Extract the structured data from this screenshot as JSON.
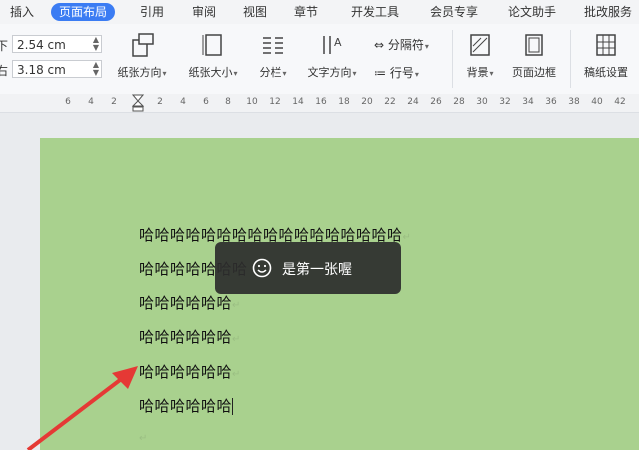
{
  "menu": {
    "tabs": [
      "插入",
      "页面布局",
      "引用",
      "审阅",
      "视图",
      "章节",
      "开发工具",
      "会员专享",
      "论文助手",
      "批改服务"
    ]
  },
  "ribbon": {
    "margins": {
      "label1": "下",
      "value1": "2.54 cm",
      "label2": "右",
      "value2": "3.18 cm"
    },
    "buttons": {
      "orientation": "纸张方向",
      "size": "纸张大小",
      "columns": "分栏",
      "text_direction": "文字方向",
      "separator": "分隔符",
      "line_number": "行号",
      "background": "背景",
      "page_border": "页面边框",
      "manuscript": "稿纸设置"
    }
  },
  "ruler": {
    "ticks": [
      "6",
      "4",
      "2",
      "",
      "2",
      "4",
      "6",
      "8",
      "10",
      "12",
      "14",
      "16",
      "18",
      "20",
      "22",
      "24",
      "26",
      "28",
      "30",
      "32",
      "34",
      "36",
      "38",
      "40",
      "42"
    ]
  },
  "document": {
    "lines": [
      "哈哈哈哈哈哈哈哈哈哈哈哈哈哈哈哈哈",
      "哈哈哈哈哈哈哈",
      "哈哈哈哈哈哈",
      "哈哈哈哈哈哈",
      "哈哈哈哈哈哈",
      "哈哈哈哈哈哈"
    ],
    "para_mark": "↵"
  },
  "toast": {
    "message": "是第一张喔"
  },
  "colors": {
    "page_bg": "#a9d18e",
    "accent": "#3b7cf3",
    "arrow": "#e53935"
  }
}
